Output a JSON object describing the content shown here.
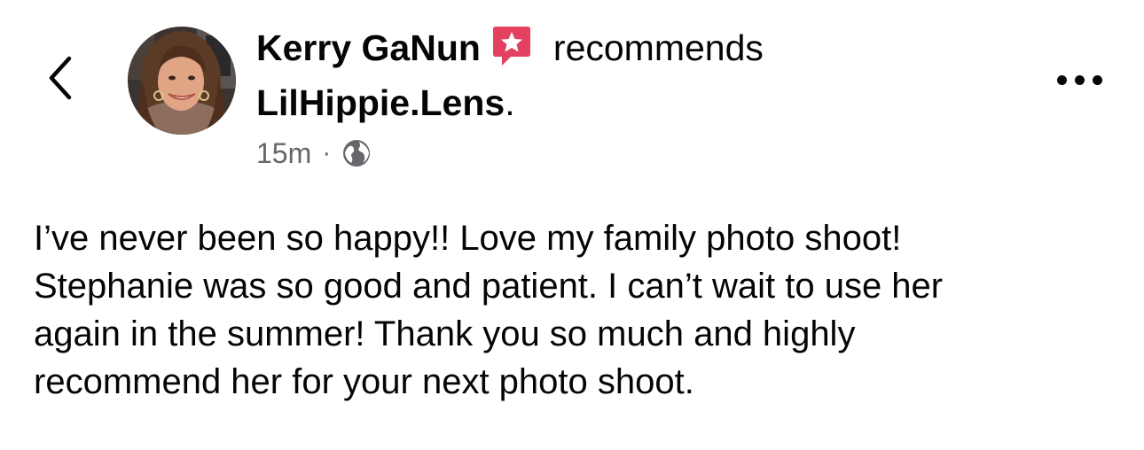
{
  "post": {
    "author_name": "Kerry GaNun",
    "action": "recommends",
    "page_name": "LilHippie.Lens",
    "page_suffix": ".",
    "timestamp": "15m",
    "separator": "·",
    "privacy_icon": "globe-icon",
    "body": "I’ve never been so happy!! Love my family photo shoot!\nStephanie was so good and patient. I can’t wait to use her\nagain in the summer! Thank you so much and highly\nrecommend her for your next photo shoot."
  },
  "icons": {
    "back": "chevron-left-icon",
    "badge": "recommend-star-icon",
    "more": "more-options-icon"
  },
  "colors": {
    "badge": "#e4405f",
    "text": "#050505",
    "meta": "#65676b"
  }
}
